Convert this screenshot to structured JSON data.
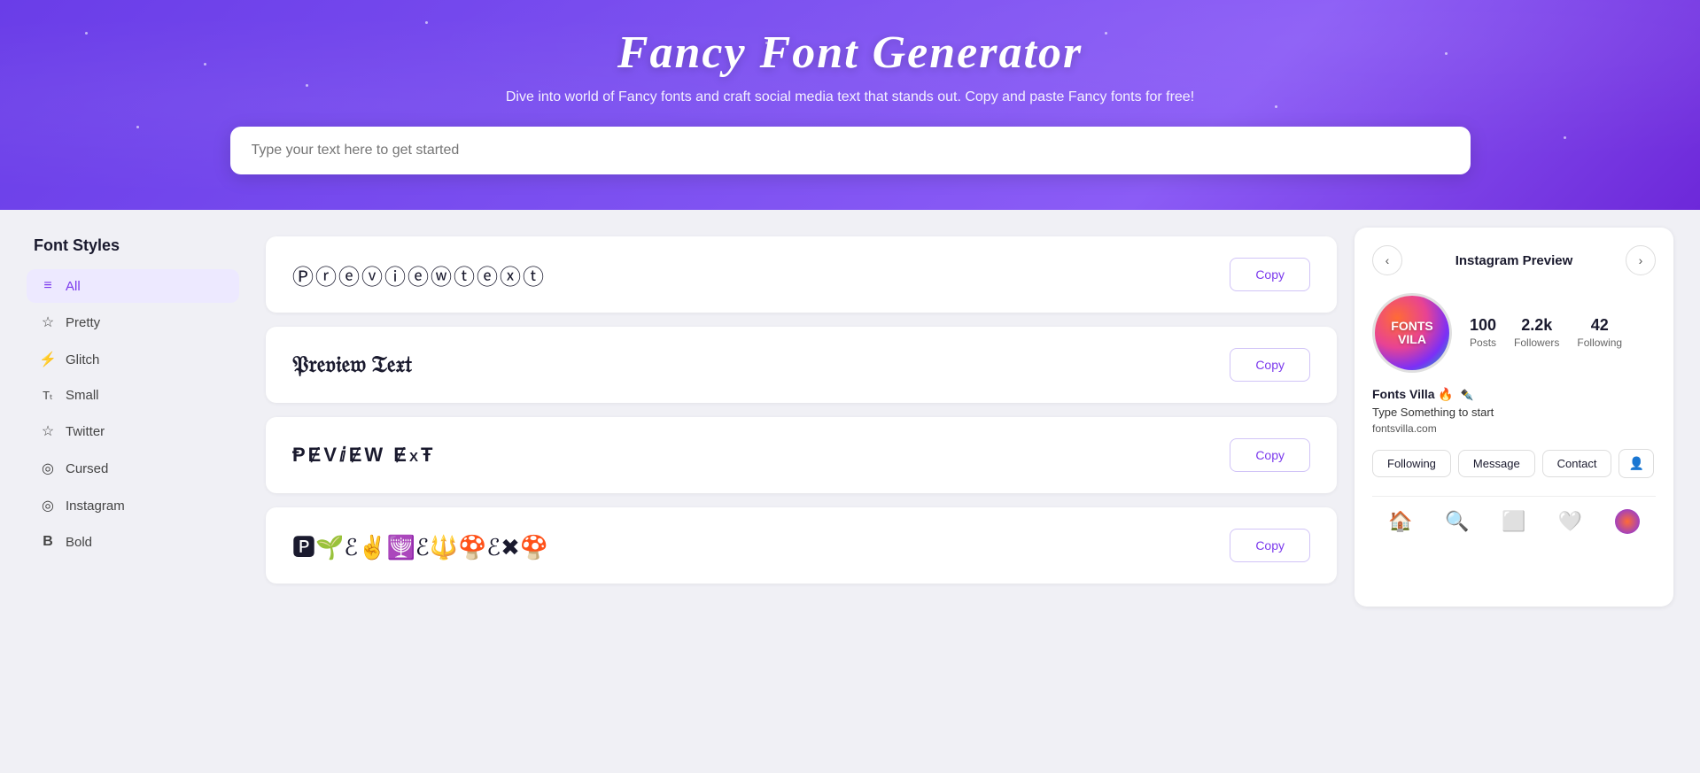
{
  "header": {
    "title": "Fancy Font Generator",
    "subtitle": "Dive into world of Fancy fonts and craft social media text that stands out. Copy and paste Fancy fonts for free!",
    "input_placeholder": "Type your text here to get started"
  },
  "sidebar": {
    "title": "Font Styles",
    "items": [
      {
        "id": "all",
        "label": "All",
        "icon": "≡",
        "active": true
      },
      {
        "id": "pretty",
        "label": "Pretty",
        "icon": "☆"
      },
      {
        "id": "glitch",
        "label": "Glitch",
        "icon": "⚡"
      },
      {
        "id": "small",
        "label": "Small",
        "icon": "Tₜ"
      },
      {
        "id": "twitter",
        "label": "Twitter",
        "icon": "☆"
      },
      {
        "id": "cursed",
        "label": "Cursed",
        "icon": "◎"
      },
      {
        "id": "instagram",
        "label": "Instagram",
        "icon": "◎"
      },
      {
        "id": "bold",
        "label": "Bold",
        "icon": "B"
      }
    ]
  },
  "font_cards": [
    {
      "id": "card1",
      "preview": "Ⓟⓡⓔⓥⓘⓔⓦⓣⓔⓧⓣ",
      "style": "circled",
      "copy_label": "Copy"
    },
    {
      "id": "card2",
      "preview": "𝔓𝔯𝔢𝔳𝔦𝔢𝔴 𝔗𝔢𝔵𝔱",
      "style": "gothic",
      "copy_label": "Copy"
    },
    {
      "id": "card3",
      "preview": "ⱣɆVⅈɆW ɆxŦ",
      "style": "mixed",
      "copy_label": "Copy"
    },
    {
      "id": "card4",
      "preview": "🅿🌱ℰ✌🕎ℰ🔱🍄ℰ✖🍄",
      "style": "emoji",
      "copy_label": "Copy"
    }
  ],
  "instagram_preview": {
    "title": "Instagram Preview",
    "prev_label": "<",
    "next_label": ">",
    "avatar_text": "FONTS\nVILA",
    "stats": [
      {
        "value": "100",
        "label": "Posts"
      },
      {
        "value": "2.2k",
        "label": "Followers"
      },
      {
        "value": "42",
        "label": "Following"
      }
    ],
    "username": "Fonts Villa 🔥",
    "username_extra": "✒️",
    "bio": "Type Something to start",
    "link": "fontsvilla.com",
    "buttons": [
      {
        "label": "Following"
      },
      {
        "label": "Message"
      },
      {
        "label": "Contact"
      }
    ],
    "footer_icons": [
      "home",
      "search",
      "add-post",
      "heart",
      "avatar"
    ]
  }
}
